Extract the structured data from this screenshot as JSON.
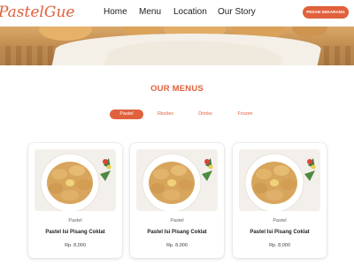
{
  "brand": {
    "logo_text": "PastelGue",
    "accent": "#e0613c"
  },
  "nav": {
    "items": [
      "Home",
      "Menu",
      "Location",
      "Our Story"
    ]
  },
  "header": {
    "order_label": "PESAN SEKARANG"
  },
  "hero": {
    "image": "basket-of-pastries"
  },
  "menu_section": {
    "title": "OUR MENUS",
    "tabs": [
      {
        "label": "Pastel",
        "active": true
      },
      {
        "label": "Risoles",
        "active": false
      },
      {
        "label": "Drinks",
        "active": false
      },
      {
        "label": "Frozen",
        "active": false
      }
    ],
    "products": [
      {
        "category": "Pastel",
        "name": "Pastel Isi Pisang Coklat",
        "price": "Rp. 8,000",
        "image": "pastel-plate"
      },
      {
        "category": "Pastel",
        "name": "Pastel Isi Pisang Coklat",
        "price": "Rp. 8,000",
        "image": "pastel-plate"
      },
      {
        "category": "Pastel",
        "name": "Pastel Isi Pisang Coklat",
        "price": "Rp. 8,000",
        "image": "pastel-plate"
      }
    ]
  }
}
